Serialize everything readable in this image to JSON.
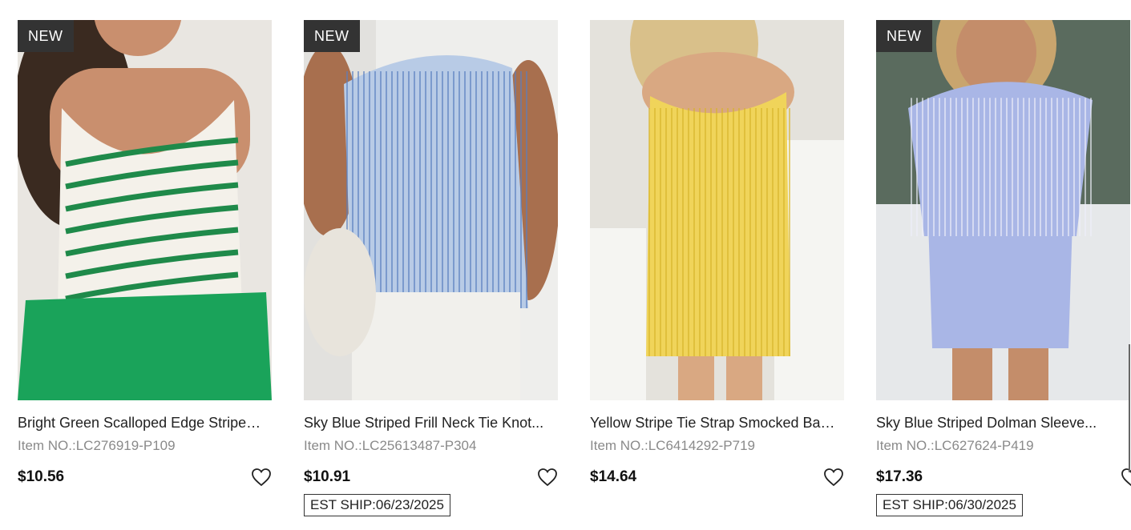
{
  "products": [
    {
      "badge": "NEW",
      "title": "Bright Green Scalloped Edge Striped...",
      "item_no": "Item NO.:LC276919-P109",
      "price": "$10.56",
      "ship": "",
      "colors": {
        "bg": "#e9e6e1",
        "top": "#f4f1ea",
        "stripe": "#1f8a4a",
        "bottom": "#1aa35a",
        "skin": "#c98f6e",
        "hair": "#3a2a20"
      }
    },
    {
      "badge": "NEW",
      "title": "Sky Blue Striped Frill Neck Tie Knot...",
      "item_no": "Item NO.:LC25613487-P304",
      "price": "$10.91",
      "ship": "EST SHIP:06/23/2025",
      "colors": {
        "bg": "#eeeeec",
        "top": "#b8cbe6",
        "stripe": "#5a7fc0",
        "bottom": "#f1f0ec",
        "skin": "#a86f4e",
        "hair": "#2b1d16"
      }
    },
    {
      "badge": "",
      "title": "Yellow Stripe Tie Strap Smocked Bac...",
      "item_no": "Item NO.:LC6414292-P719",
      "price": "$14.64",
      "ship": "",
      "colors": {
        "bg": "#e4e2dc",
        "top": "#f0d45a",
        "stripe": "#d9b52c",
        "bottom": "#f0d45a",
        "skin": "#d9a882",
        "hair": "#d9c08a"
      }
    },
    {
      "badge": "NEW",
      "title": "Sky Blue Striped Dolman Sleeve...",
      "item_no": "Item NO.:LC627624-P419",
      "price": "$17.36",
      "ship": "EST SHIP:06/30/2025",
      "colors": {
        "bg": "#dfe3e6",
        "top": "#a9b6e6",
        "stripe": "#eef0fa",
        "bottom": "#a9b6e6",
        "skin": "#c48d6a",
        "hair": "#c9a56e"
      }
    }
  ]
}
